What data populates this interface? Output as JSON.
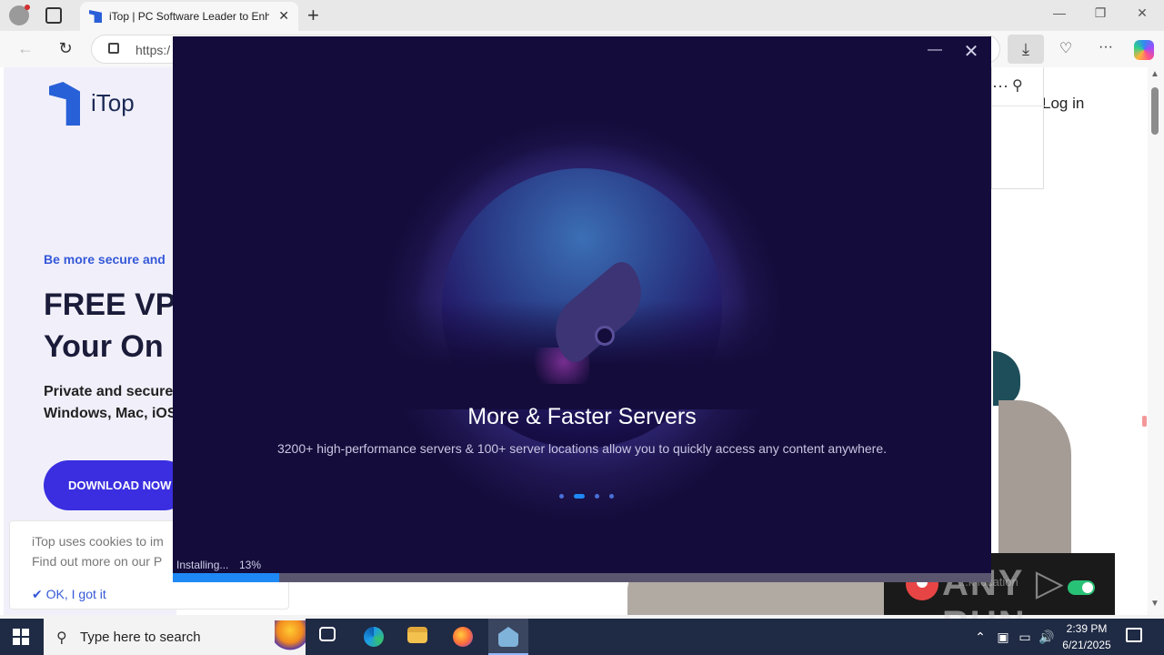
{
  "browser": {
    "tab_title": "iTop | PC Software Leader to Enha",
    "tab_close": "✕",
    "new_tab": "+",
    "url": "https:/",
    "window_controls": {
      "minimize": "—",
      "maximize": "❐",
      "close": "✕"
    },
    "nav": {
      "back": "←",
      "refresh": "↻"
    },
    "download_icon": "⤓",
    "heart_icon": "♡",
    "more": "···"
  },
  "webpage": {
    "logo_text": "iTop",
    "tagline": "Be more secure and",
    "headline_1": "FREE VP",
    "headline_2": "Your On",
    "subtext_1": "Private and secure",
    "subtext_2": "Windows, Mac, iOS",
    "download_button": "DOWNLOAD NOW",
    "login": "Log in",
    "cookie": {
      "line1": "iTop uses cookies to im",
      "line2": "Find out more on our P",
      "ok": "OK, I got it"
    },
    "download_panel": {
      "more": "···",
      "pin": "⚲"
    }
  },
  "anyrun": {
    "location_label": "...k location",
    "logo": "ANY ▷ RUN"
  },
  "installer": {
    "minimize": "—",
    "close": "✕",
    "slide_title": "More & Faster Servers",
    "slide_desc": "3200+ high-performance servers & 100+ server locations allow you to quickly access any content anywhere.",
    "slide_count": 4,
    "active_slide": 1,
    "status": "Installing...",
    "percent_label": "13%",
    "progress": 0.13,
    "accent": "#1e88f5",
    "background": "#140c3a"
  },
  "taskbar": {
    "search_placeholder": "Type here to search",
    "time": "2:39 PM",
    "date": "6/21/2025",
    "apps": [
      "task-view",
      "edge",
      "file-explorer",
      "firefox",
      "installer"
    ],
    "tray": {
      "chevron": "⌃",
      "volume": "🔊"
    }
  }
}
